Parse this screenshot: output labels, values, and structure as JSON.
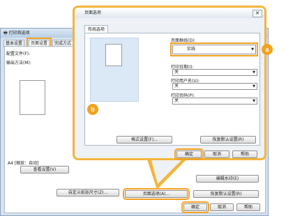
{
  "background_window": {
    "title": "打印首选项",
    "tabs": [
      "基本设置",
      "页面设置",
      "完成方式"
    ],
    "labels": {
      "layout_file": "配置文件(F):",
      "output_method": "输出方法(M):",
      "page_info": "A4  [缩放：自动]",
      "view_settings": "查看设置(V)",
      "edit_watermark": "编辑水印(E)",
      "custom_paper": "自定义纸张尺寸(Z)..."
    },
    "buttons": {
      "page_options": "页面选项(A)...",
      "restore_defaults": "恢复默认设置(R)",
      "ok": "确定",
      "cancel": "取消",
      "help": "帮助"
    }
  },
  "dialog": {
    "title": "页面选项",
    "close_icon": "close-icon",
    "tab": "布局选项",
    "fields": [
      {
        "label": "页面框线(D):",
        "value": "实线"
      },
      {
        "label": "打印日期(I):",
        "value": "关"
      },
      {
        "label": "打印用户名(U):",
        "value": "关"
      },
      {
        "label": "打印页码(P):",
        "value": "关"
      }
    ],
    "buttons": {
      "format_settings": "格式设置(F)...",
      "restore_defaults": "恢复默认设置(R)",
      "ok": "确定",
      "cancel": "取消",
      "help": "帮助"
    }
  },
  "callouts": {
    "a": "a",
    "b": "b"
  },
  "colors": {
    "highlight": "#f4a11f",
    "dialog_border": "#f4b53a",
    "preview_bg": "#dbe8f6"
  }
}
